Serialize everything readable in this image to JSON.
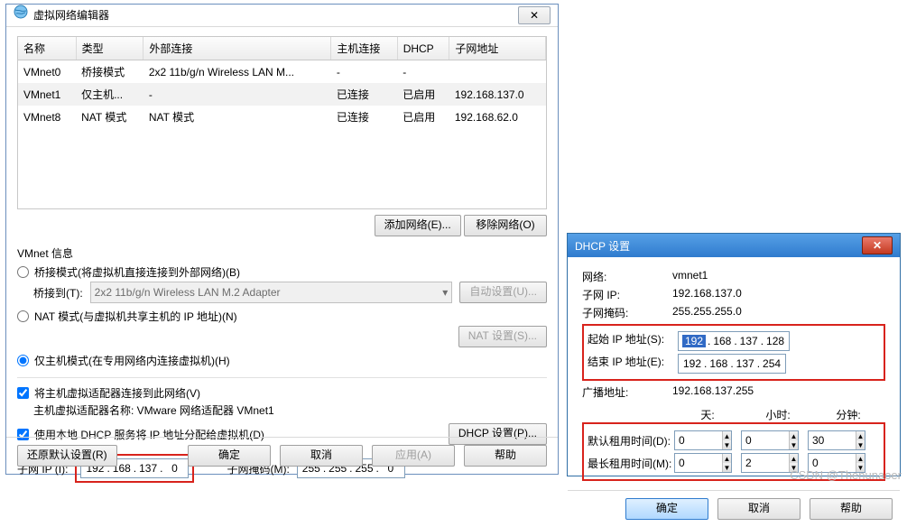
{
  "win1": {
    "title": "虚拟网络编辑器",
    "columns": [
      "名称",
      "类型",
      "外部连接",
      "主机连接",
      "DHCP",
      "子网地址"
    ],
    "rows": [
      {
        "c": [
          "VMnet0",
          "桥接模式",
          "2x2 11b/g/n Wireless LAN M...",
          "-",
          "-",
          ""
        ]
      },
      {
        "c": [
          "VMnet1",
          "仅主机...",
          "-",
          "已连接",
          "已启用",
          "192.168.137.0"
        ],
        "sel": true
      },
      {
        "c": [
          "VMnet8",
          "NAT 模式",
          "NAT 模式",
          "已连接",
          "已启用",
          "192.168.62.0"
        ]
      }
    ],
    "addNet": "添加网络(E)...",
    "removeNet": "移除网络(O)",
    "info": "VMnet 信息",
    "r_bridge": "桥接模式(将虚拟机直接连接到外部网络)(B)",
    "bridgeTo": "桥接到(T):",
    "bridgeAdapter": "2x2 11b/g/n Wireless LAN M.2 Adapter",
    "autoSet": "自动设置(U)...",
    "r_nat": "NAT 模式(与虚拟机共享主机的 IP 地址)(N)",
    "natSet": "NAT 设置(S)...",
    "r_host": "仅主机模式(在专用网络内连接虚拟机)(H)",
    "c_connect": "将主机虚拟适配器连接到此网络(V)",
    "adapterName": "主机虚拟适配器名称: VMware 网络适配器 VMnet1",
    "c_dhcp": "使用本地 DHCP 服务将 IP 地址分配给虚拟机(D)",
    "dhcpSet": "DHCP 设置(P)...",
    "subnetIp": "子网 IP (I):",
    "ip": [
      "192",
      "168",
      "137",
      "0"
    ],
    "subnetMask": "子网掩码(M):",
    "mask": [
      "255",
      "255",
      "255",
      "0"
    ],
    "restore": "还原默认设置(R)",
    "ok": "确定",
    "cancel": "取消",
    "apply": "应用(A)",
    "help": "帮助"
  },
  "win2": {
    "title": "DHCP 设置",
    "net_l": "网络:",
    "net_v": "vmnet1",
    "sub_l": "子网 IP:",
    "sub_v": "192.168.137.0",
    "mask_l": "子网掩码:",
    "mask_v": "255.255.255.0",
    "start_l": "起始 IP 地址(S):",
    "start": [
      "192",
      "168",
      "137",
      "128"
    ],
    "end_l": "结束 IP 地址(E):",
    "end": [
      "192",
      "168",
      "137",
      "254"
    ],
    "bcast_l": "广播地址:",
    "bcast_v": "192.168.137.255",
    "days": "天:",
    "hours": "小时:",
    "mins": "分钟:",
    "def_l": "默认租用时间(D):",
    "def": [
      "0",
      "0",
      "30"
    ],
    "max_l": "最长租用时间(M):",
    "max": [
      "0",
      "2",
      "0"
    ],
    "ok": "确定",
    "cancel": "取消",
    "help": "帮助"
  },
  "watermark": "CSDN @Thenunaoer"
}
